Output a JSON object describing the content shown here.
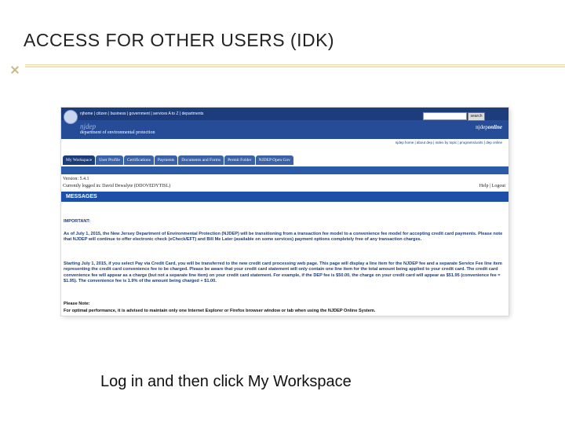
{
  "slide": {
    "title": "ACCESS FOR OTHER USERS (IDK)",
    "caption": "Log in and then click My Workspace"
  },
  "screenshot": {
    "top_links": "njhome | citizen | business | government | services A to Z | departments",
    "search_button": "search",
    "dep_logo_mark": "njdep",
    "dep_logo_text": "department of environmental protection",
    "njdep_online_prefix": "njdep",
    "njdep_online_suffix": "online",
    "sub_links": "njdep home | about dep | index by topic | programs/units | dep online",
    "tabs": [
      "My Workspace",
      "User Profile",
      "Certifications",
      "Payments",
      "Documents and Forms",
      "Permit Folder",
      "NJDEP Open Gov"
    ],
    "version": "Version: 5.4.1",
    "logged_in": "Currently logged in: David Dewalyte (DDOVEDYTISL)",
    "help_logout": "Help | Logout",
    "messages_label": "MESSAGES",
    "important": "IMPORTANT:",
    "paragraph1": "As of July 1, 2015, the New Jersey Department of Environmental Protection (NJDEP) will be transitioning from a transaction fee model to a convenience fee model for accepting credit card payments. Please note that NJDEP will continue to offer electronic check (eCheck/EFT) and Bill Me Later (available on some services) payment options completely free of any transaction charges.",
    "paragraph2": "Starting July 1, 2015, if you select Pay via Credit Card, you will be transferred to the new credit card processing web page. This page will display a line item for the NJDEP fee and a separate Service Fee line item representing the credit card convenience fee to be charged. Please be aware that your credit card statement will only contain one line item for the total amount being applied to your credit card. The credit card convenience fee will appear as a charge (but not a separate line item) on your credit card statement. For example, if the DEP fee is $50.00, the charge on your credit card will appear as $51.95 (convenience fee = $1.95). The convenience fee is 1.9% of the amount being charged + $1.00.",
    "note_title": "Please Note:",
    "note": "For optimal performance, it is advised to maintain only one Internet Explorer or Firefox browser window or tab when using the NJDEP Online System."
  },
  "colors": {
    "header_blue": "#264c97",
    "messages_blue": "#1e4fa8",
    "message_text": "#1d3c7b"
  }
}
